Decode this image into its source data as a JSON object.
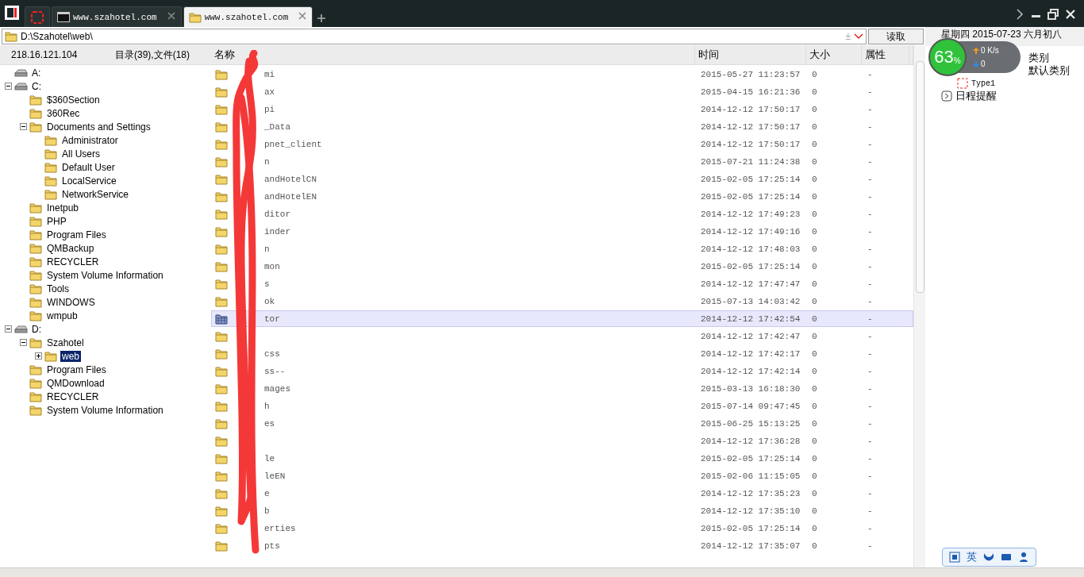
{
  "tabs": [
    {
      "kind": "icon",
      "selected": false
    },
    {
      "kind": "terminal",
      "label": "www.szahotel.com",
      "selected": false
    },
    {
      "kind": "folder",
      "label": "www.szahotel.com",
      "selected": true
    }
  ],
  "address": {
    "value": "D:\\Szahotel\\web\\",
    "toggle": "±",
    "button": "读取"
  },
  "tree_header": {
    "host": "218.16.121.104",
    "counts": "目录(39),文件(18)"
  },
  "tree": [
    {
      "kind": "drive",
      "label": "A:",
      "selected": false
    },
    {
      "kind": "drive",
      "label": "C:",
      "expanded": true,
      "selected": false,
      "children": [
        {
          "kind": "folder",
          "label": "$360Section",
          "selected": false
        },
        {
          "kind": "folder",
          "label": "360Rec",
          "selected": false
        },
        {
          "kind": "folder",
          "label": "Documents and Settings",
          "expanded": true,
          "selected": false,
          "children": [
            {
              "kind": "folder",
              "label": "Administrator",
              "selected": false
            },
            {
              "kind": "folder",
              "label": "All Users",
              "selected": false
            },
            {
              "kind": "folder",
              "label": "Default User",
              "selected": false
            },
            {
              "kind": "folder",
              "label": "LocalService",
              "selected": false
            },
            {
              "kind": "folder",
              "label": "NetworkService",
              "selected": false
            }
          ]
        },
        {
          "kind": "folder",
          "label": "Inetpub",
          "selected": false
        },
        {
          "kind": "folder",
          "label": "PHP",
          "selected": false
        },
        {
          "kind": "folder",
          "label": "Program Files",
          "selected": false
        },
        {
          "kind": "folder",
          "label": "QMBackup",
          "selected": false
        },
        {
          "kind": "folder",
          "label": "RECYCLER",
          "selected": false
        },
        {
          "kind": "folder",
          "label": "System Volume Information",
          "selected": false
        },
        {
          "kind": "folder",
          "label": "Tools",
          "selected": false
        },
        {
          "kind": "folder",
          "label": "WINDOWS",
          "selected": false
        },
        {
          "kind": "folder",
          "label": "wmpub",
          "selected": false
        }
      ]
    },
    {
      "kind": "drive",
      "label": "D:",
      "expanded": true,
      "selected": false,
      "children": [
        {
          "kind": "folder",
          "label": "Szahotel",
          "expanded": true,
          "selected": false,
          "children": [
            {
              "kind": "folder",
              "label": "web",
              "expanded": false,
              "selected": true
            }
          ]
        },
        {
          "kind": "folder",
          "label": "Program Files",
          "selected": false
        },
        {
          "kind": "folder",
          "label": "QMDownload",
          "selected": false
        },
        {
          "kind": "folder",
          "label": "RECYCLER",
          "selected": false
        },
        {
          "kind": "folder",
          "label": "System Volume Information",
          "selected": false
        }
      ]
    }
  ],
  "table": {
    "columns": [
      "名称",
      "时间",
      "大小",
      "属性"
    ],
    "rows": [
      {
        "name": "mi",
        "time": "2015-05-27 11:23:57",
        "size": "0",
        "attr": "-",
        "selected": false
      },
      {
        "name": "ax",
        "time": "2015-04-15 16:21:36",
        "size": "0",
        "attr": "-",
        "selected": false
      },
      {
        "name": "pi",
        "time": "2014-12-12 17:50:17",
        "size": "0",
        "attr": "-",
        "selected": false
      },
      {
        "name": "_Data",
        "time": "2014-12-12 17:50:17",
        "size": "0",
        "attr": "-",
        "selected": false
      },
      {
        "name": "pnet_client",
        "time": "2014-12-12 17:50:17",
        "size": "0",
        "attr": "-",
        "selected": false
      },
      {
        "name": "n",
        "time": "2015-07-21 11:24:38",
        "size": "0",
        "attr": "-",
        "selected": false
      },
      {
        "name": "andHotelCN",
        "time": "2015-02-05 17:25:14",
        "size": "0",
        "attr": "-",
        "selected": false
      },
      {
        "name": "andHotelEN",
        "time": "2015-02-05 17:25:14",
        "size": "0",
        "attr": "-",
        "selected": false
      },
      {
        "name": "ditor",
        "time": "2014-12-12 17:49:23",
        "size": "0",
        "attr": "-",
        "selected": false
      },
      {
        "name": "inder",
        "time": "2014-12-12 17:49:16",
        "size": "0",
        "attr": "-",
        "selected": false
      },
      {
        "name": "n",
        "time": "2014-12-12 17:48:03",
        "size": "0",
        "attr": "-",
        "selected": false
      },
      {
        "name": "mon",
        "time": "2015-02-05 17:25:14",
        "size": "0",
        "attr": "-",
        "selected": false
      },
      {
        "name": "s",
        "time": "2014-12-12 17:47:47",
        "size": "0",
        "attr": "-",
        "selected": false
      },
      {
        "name": "ok",
        "time": "2015-07-13 14:03:42",
        "size": "0",
        "attr": "-",
        "selected": false
      },
      {
        "name": "tor",
        "time": "2014-12-12 17:42:54",
        "size": "0",
        "attr": "-",
        "selected": true
      },
      {
        "time": "2014-12-12 17:42:47",
        "size": "0",
        "attr": "-",
        "selected": false
      },
      {
        "name": "css",
        "time": "2014-12-12 17:42:17",
        "size": "0",
        "attr": "-",
        "selected": false
      },
      {
        "name": "ss--",
        "time": "2014-12-12 17:42:14",
        "size": "0",
        "attr": "-",
        "selected": false
      },
      {
        "name": "mages",
        "time": "2015-03-13 16:18:30",
        "size": "0",
        "attr": "-",
        "selected": false
      },
      {
        "name": "h",
        "time": "2015-07-14 09:47:45",
        "size": "0",
        "attr": "-",
        "selected": false
      },
      {
        "name": "es",
        "time": "2015-06-25 15:13:25",
        "size": "0",
        "attr": "-",
        "selected": false
      },
      {
        "time": "2014-12-12 17:36:28",
        "size": "0",
        "attr": "-",
        "selected": false
      },
      {
        "name": "le",
        "time": "2015-02-05 17:25:14",
        "size": "0",
        "attr": "-",
        "selected": false
      },
      {
        "name": "leEN",
        "time": "2015-02-06 11:15:05",
        "size": "0",
        "attr": "-",
        "selected": false
      },
      {
        "name": "e",
        "time": "2014-12-12 17:35:23",
        "size": "0",
        "attr": "-",
        "selected": false
      },
      {
        "name": "b",
        "time": "2014-12-12 17:35:10",
        "size": "0",
        "attr": "-",
        "selected": false
      },
      {
        "name": "erties",
        "time": "2015-02-05 17:25:14",
        "size": "0",
        "attr": "-",
        "selected": false
      },
      {
        "name": "pts",
        "time": "2014-12-12 17:35:07",
        "size": "0",
        "attr": "-",
        "selected": false
      }
    ]
  },
  "side_panel": {
    "date": "星期四 2015-07-23 六月初八",
    "items": [
      {
        "kind": "category",
        "label": "类别"
      },
      {
        "kind": "category",
        "label": "默认类别"
      },
      {
        "kind": "type",
        "label": "Type1"
      },
      {
        "kind": "reminder",
        "label": "日程提醒"
      }
    ]
  },
  "speed_widget": {
    "percent": "63",
    "unit": "%",
    "up": "0",
    "up_unit": "K/s",
    "down": "0"
  },
  "ime_bar": {
    "mode": "英"
  }
}
